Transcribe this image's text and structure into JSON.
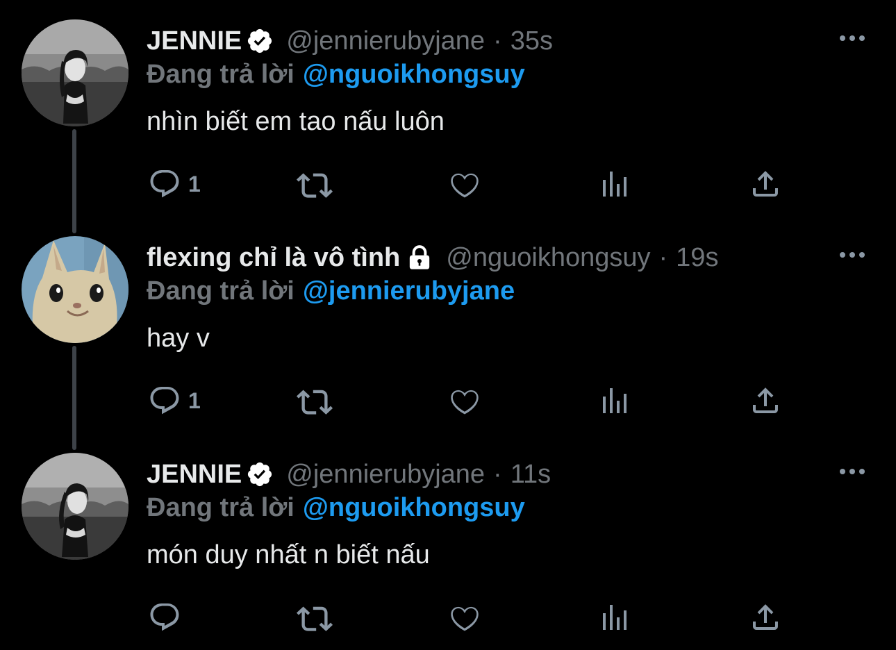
{
  "colors": {
    "background": "#000000",
    "primary_text": "#e7e9ea",
    "secondary_text": "#71767b",
    "mention": "#1d9bf0",
    "action_icon": "#8b98a5",
    "thread_line": "#3d4248"
  },
  "tweets": [
    {
      "display_name": "JENNIE",
      "badge_icon": "verified-badge-icon",
      "handle": "@jennierubyjane",
      "separator": "·",
      "time": "35s",
      "reply_prefix": "Đang trả lời",
      "reply_to": "@nguoikhongsuy",
      "text": "nhìn biết em tao nấu luôn",
      "reply_count": "1",
      "avatar_icon": "woman-photo-avatar"
    },
    {
      "display_name": "flexing chỉ là vô tình",
      "badge_icon": "lock-icon",
      "handle": "@nguoikhongsuy",
      "separator": "·",
      "time": "19s",
      "reply_prefix": "Đang trả lời",
      "reply_to": "@jennierubyjane",
      "text": "hay v",
      "reply_count": "1",
      "avatar_icon": "cat-photo-avatar"
    },
    {
      "display_name": "JENNIE",
      "badge_icon": "verified-badge-icon",
      "handle": "@jennierubyjane",
      "separator": "·",
      "time": "11s",
      "reply_prefix": "Đang trả lời",
      "reply_to": "@nguoikhongsuy",
      "text": "món duy nhất n biết nấu",
      "reply_count": "",
      "avatar_icon": "woman-photo-avatar"
    }
  ],
  "action_icons": [
    "reply-icon",
    "retweet-icon",
    "like-icon",
    "views-icon",
    "share-icon"
  ],
  "more_icon": "more-options-icon"
}
